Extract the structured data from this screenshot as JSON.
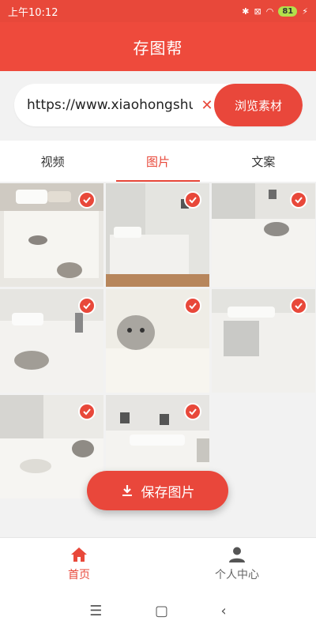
{
  "status_bar": {
    "time": "上午10:12",
    "battery": "81"
  },
  "app_bar": {
    "title": "存图帮"
  },
  "search": {
    "value": "https://www.xiaohongshu.com",
    "clear_icon": "close-icon",
    "browse_label": "浏览素材"
  },
  "tabs": [
    {
      "label": "视频",
      "active": false
    },
    {
      "label": "图片",
      "active": true
    },
    {
      "label": "文案",
      "active": false
    }
  ],
  "images": [
    {
      "subject": "bed-with-cat-and-pillows",
      "selected": true
    },
    {
      "subject": "bedroom-window-view",
      "selected": true
    },
    {
      "subject": "bed-with-cat-lying",
      "selected": true
    },
    {
      "subject": "cat-lying-on-bed",
      "selected": true
    },
    {
      "subject": "cat-face-closeup",
      "selected": true
    },
    {
      "subject": "bed-with-folded-duvet",
      "selected": true
    },
    {
      "subject": "cat-under-blanket",
      "selected": true
    },
    {
      "subject": "bedroom-with-frames",
      "selected": true
    }
  ],
  "save_button": {
    "label": "保存图片",
    "icon": "download-icon"
  },
  "bottom_nav": [
    {
      "label": "首页",
      "icon": "home-icon",
      "active": true
    },
    {
      "label": "个人中心",
      "icon": "person-icon",
      "active": false
    }
  ],
  "system_nav": {
    "menu": "☰",
    "home": "▢",
    "back": "‹"
  },
  "colors": {
    "accent": "#e8483a",
    "background": "#f2f2f2"
  }
}
